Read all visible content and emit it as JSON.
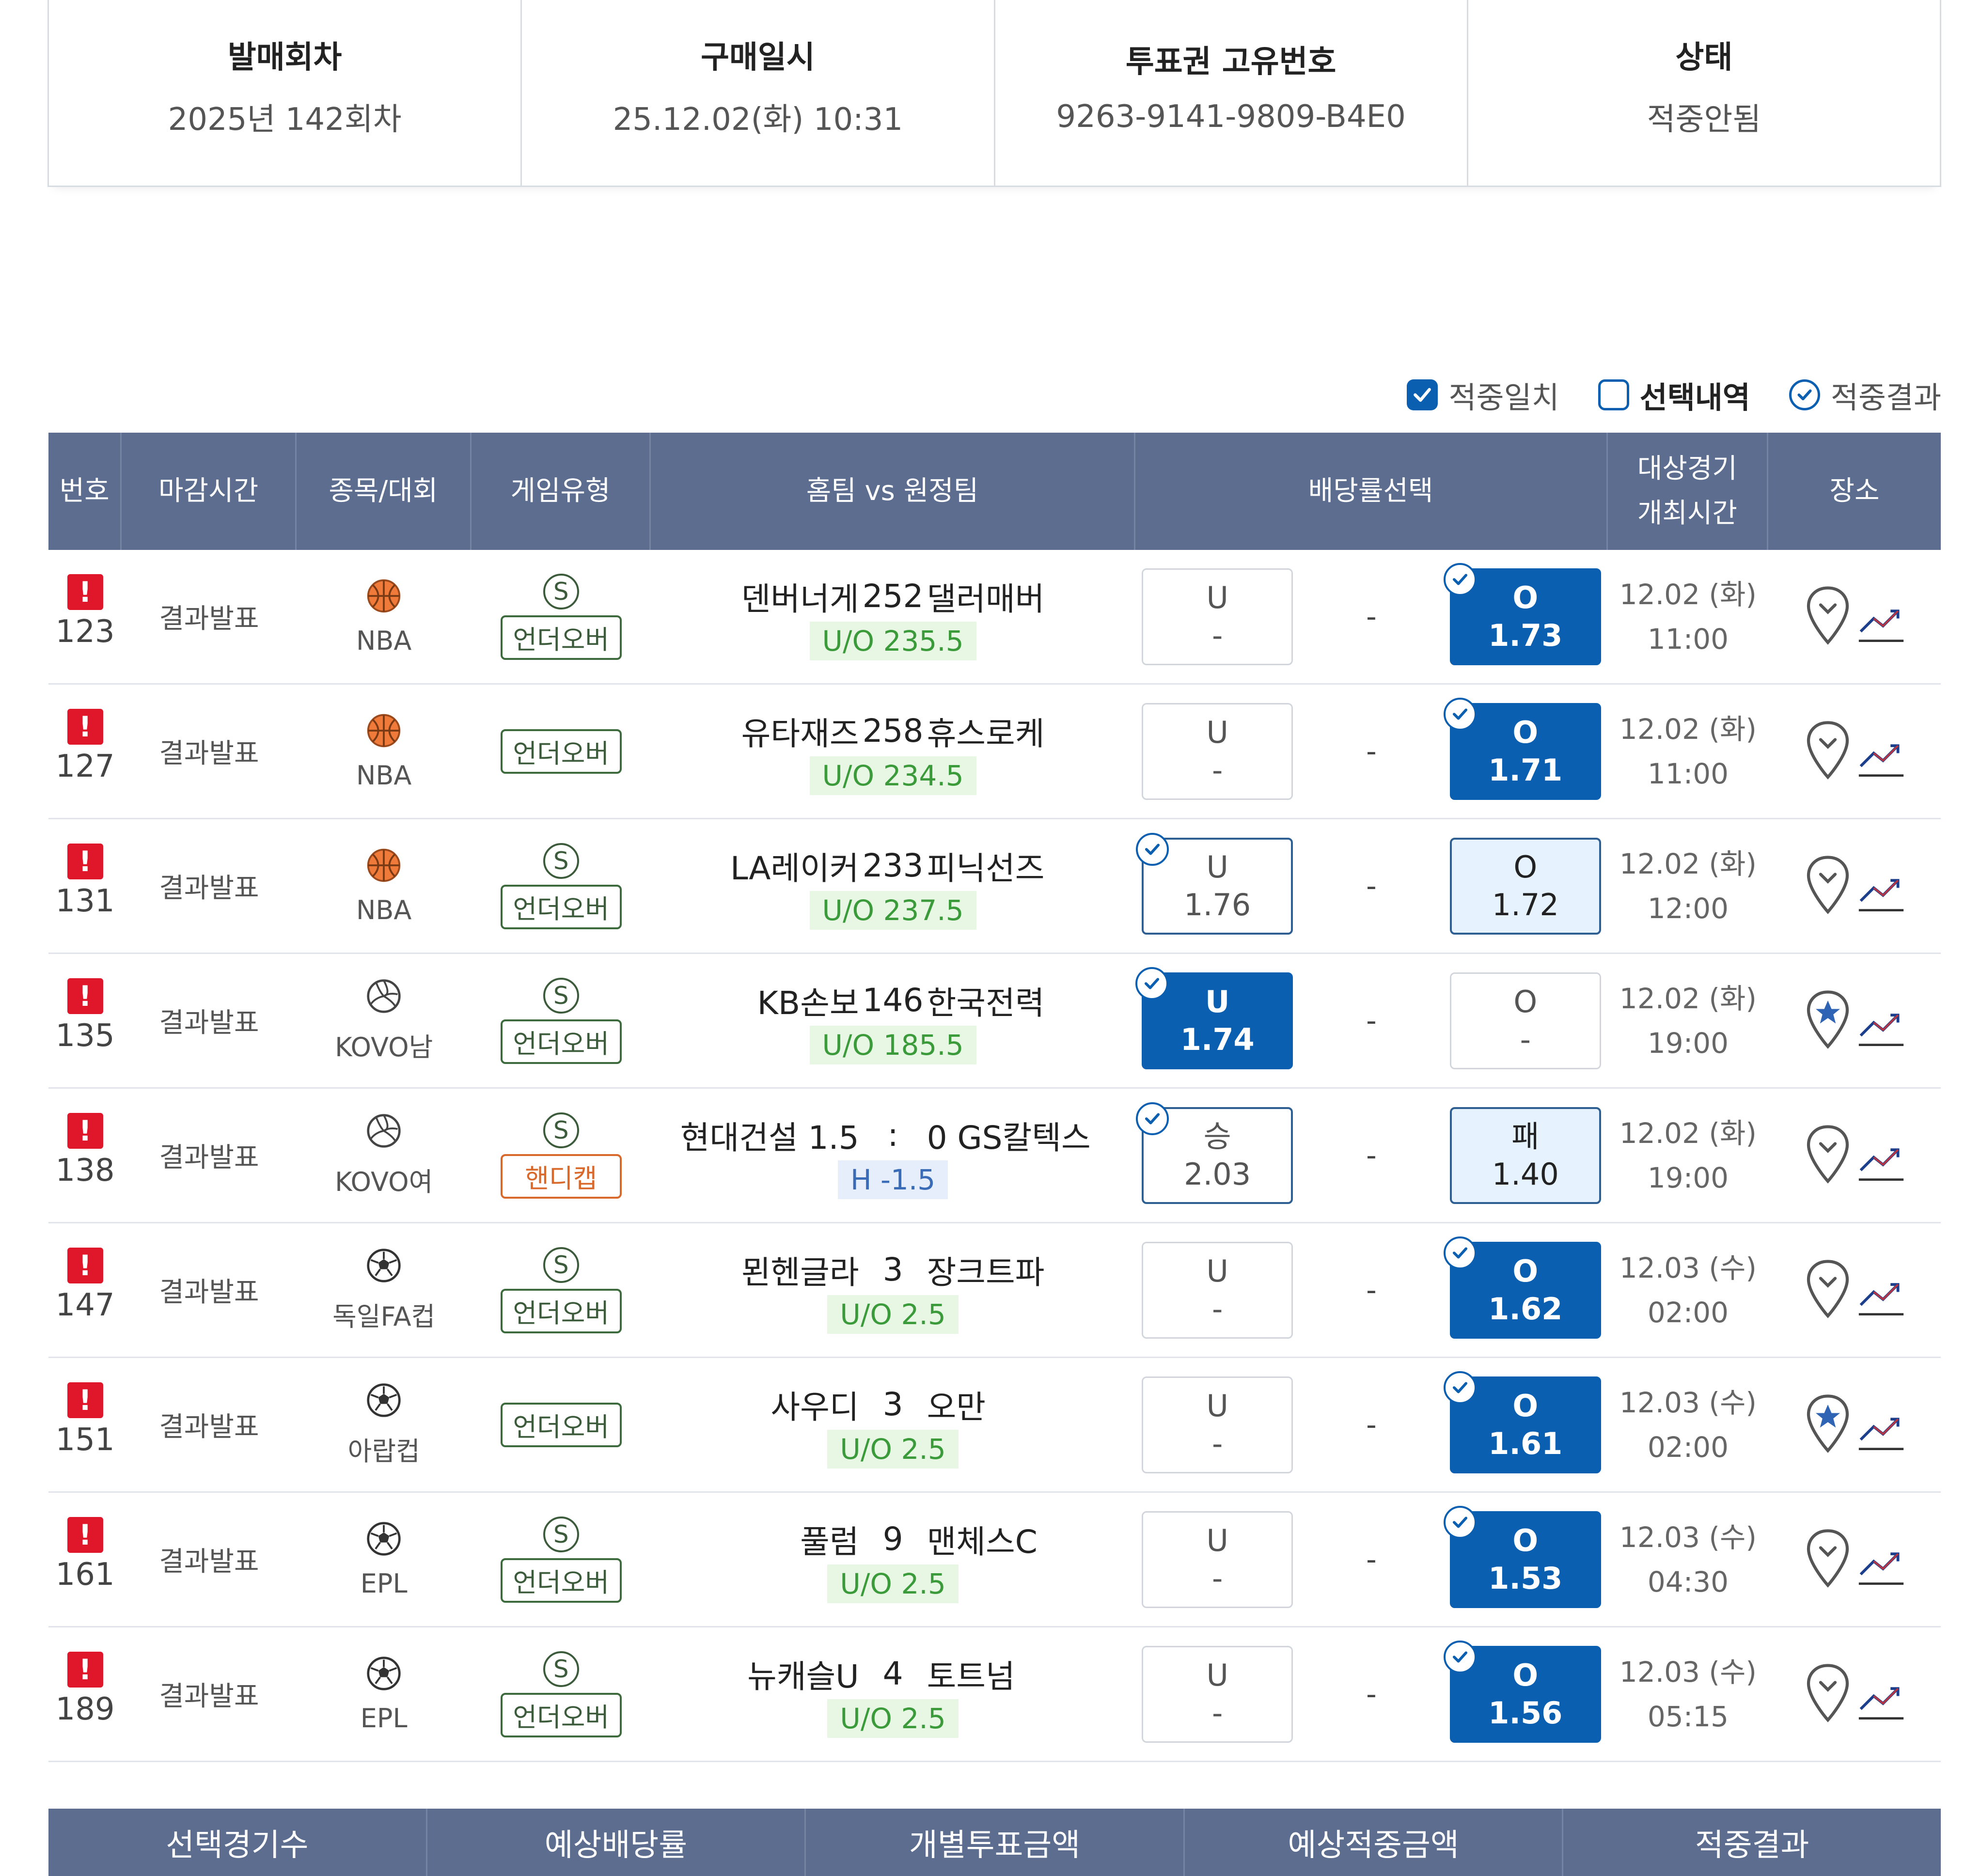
{
  "summary": [
    {
      "label": "발매회차",
      "value": "2025년 142회차"
    },
    {
      "label": "구매일시",
      "value": "25.12.02(화) 10:31"
    },
    {
      "label": "투표권 고유번호",
      "value": "9263-9141-9809-B4E0"
    },
    {
      "label": "상태",
      "value": "적중안됨"
    }
  ],
  "legend": {
    "hit_match": "적중일치",
    "selection": "선택내역",
    "hit_result": "적중결과"
  },
  "headers": {
    "no": "번호",
    "deadline": "마감시간",
    "sport": "종목/대회",
    "game_type": "게임유형",
    "match": "홈팀 vs 원정팀",
    "odds": "배당률선택",
    "game_time_1": "대상경기",
    "game_time_2": "개최시간",
    "venue": "장소"
  },
  "rows": [
    {
      "no": "123",
      "deadline": "결과발표",
      "sport": "NBA",
      "sport_icon": "basketball-icon",
      "special": "S",
      "game_type": "언더오버",
      "home": "덴버너게",
      "score": "252",
      "away": "댈러매버",
      "line": "U/O 235.5",
      "left_label": "U",
      "left_odds": "-",
      "mid": "-",
      "right_label": "O",
      "right_odds": "1.73",
      "date": "12.02 (화)",
      "time": "11:00"
    },
    {
      "no": "127",
      "deadline": "결과발표",
      "sport": "NBA",
      "sport_icon": "basketball-icon",
      "special": "",
      "game_type": "언더오버",
      "home": "유타재즈",
      "score": "258",
      "away": "휴스로케",
      "line": "U/O 234.5",
      "left_label": "U",
      "left_odds": "-",
      "mid": "-",
      "right_label": "O",
      "right_odds": "1.71",
      "date": "12.02 (화)",
      "time": "11:00"
    },
    {
      "no": "131",
      "deadline": "결과발표",
      "sport": "NBA",
      "sport_icon": "basketball-icon",
      "special": "S",
      "game_type": "언더오버",
      "home": "LA레이커",
      "score": "233",
      "away": "피닉선즈",
      "line": "U/O 237.5",
      "left_label": "U",
      "left_odds": "1.76",
      "mid": "-",
      "right_label": "O",
      "right_odds": "1.72",
      "date": "12.02 (화)",
      "time": "12:00"
    },
    {
      "no": "135",
      "deadline": "결과발표",
      "sport": "KOVO남",
      "sport_icon": "volleyball-icon",
      "special": "S",
      "game_type": "언더오버",
      "home": "KB손보",
      "score": "146",
      "away": "한국전력",
      "line": "U/O 185.5",
      "left_label": "U",
      "left_odds": "1.74",
      "mid": "-",
      "right_label": "O",
      "right_odds": "-",
      "date": "12.02 (화)",
      "time": "19:00"
    },
    {
      "no": "138",
      "deadline": "결과발표",
      "sport": "KOVO여",
      "sport_icon": "volleyball-icon",
      "special": "S",
      "game_type": "핸디캡",
      "home": "현대건설 1.5",
      "score": ":",
      "away": "0 GS칼텍스",
      "line": "H -1.5",
      "left_label": "승",
      "left_odds": "2.03",
      "mid": "-",
      "right_label": "패",
      "right_odds": "1.40",
      "date": "12.02 (화)",
      "time": "19:00"
    },
    {
      "no": "147",
      "deadline": "결과발표",
      "sport": "독일FA컵",
      "sport_icon": "soccer-ball-icon",
      "special": "S",
      "game_type": "언더오버",
      "home": "묀헨글라",
      "score": "3",
      "away": "장크트파",
      "line": "U/O 2.5",
      "left_label": "U",
      "left_odds": "-",
      "mid": "-",
      "right_label": "O",
      "right_odds": "1.62",
      "date": "12.03 (수)",
      "time": "02:00"
    },
    {
      "no": "151",
      "deadline": "결과발표",
      "sport": "아랍컵",
      "sport_icon": "soccer-ball-icon",
      "special": "",
      "game_type": "언더오버",
      "home": "사우디",
      "score": "3",
      "away": "오만",
      "line": "U/O 2.5",
      "left_label": "U",
      "left_odds": "-",
      "mid": "-",
      "right_label": "O",
      "right_odds": "1.61",
      "date": "12.03 (수)",
      "time": "02:00"
    },
    {
      "no": "161",
      "deadline": "결과발표",
      "sport": "EPL",
      "sport_icon": "soccer-ball-icon",
      "special": "S",
      "game_type": "언더오버",
      "home": "풀럼",
      "score": "9",
      "away": "맨체스C",
      "line": "U/O 2.5",
      "left_label": "U",
      "left_odds": "-",
      "mid": "-",
      "right_label": "O",
      "right_odds": "1.53",
      "date": "12.03 (수)",
      "time": "04:30"
    },
    {
      "no": "189",
      "deadline": "결과발표",
      "sport": "EPL",
      "sport_icon": "soccer-ball-icon",
      "special": "S",
      "game_type": "언더오버",
      "home": "뉴캐슬U",
      "score": "4",
      "away": "토트넘",
      "line": "U/O 2.5",
      "left_label": "U",
      "left_odds": "-",
      "mid": "-",
      "right_label": "O",
      "right_odds": "1.56",
      "date": "12.03 (수)",
      "time": "05:15"
    }
  ],
  "footer": [
    "선택경기수",
    "예상배당률",
    "개별투표금액",
    "예상적중금액",
    "적중결과"
  ],
  "colors": {
    "header_bg": "#5d6d8f",
    "selected_blue": "#0b5fb0",
    "alert_red": "#e0162b",
    "line_green": "#3b9b3b",
    "handicap_orange": "#d9682b"
  }
}
